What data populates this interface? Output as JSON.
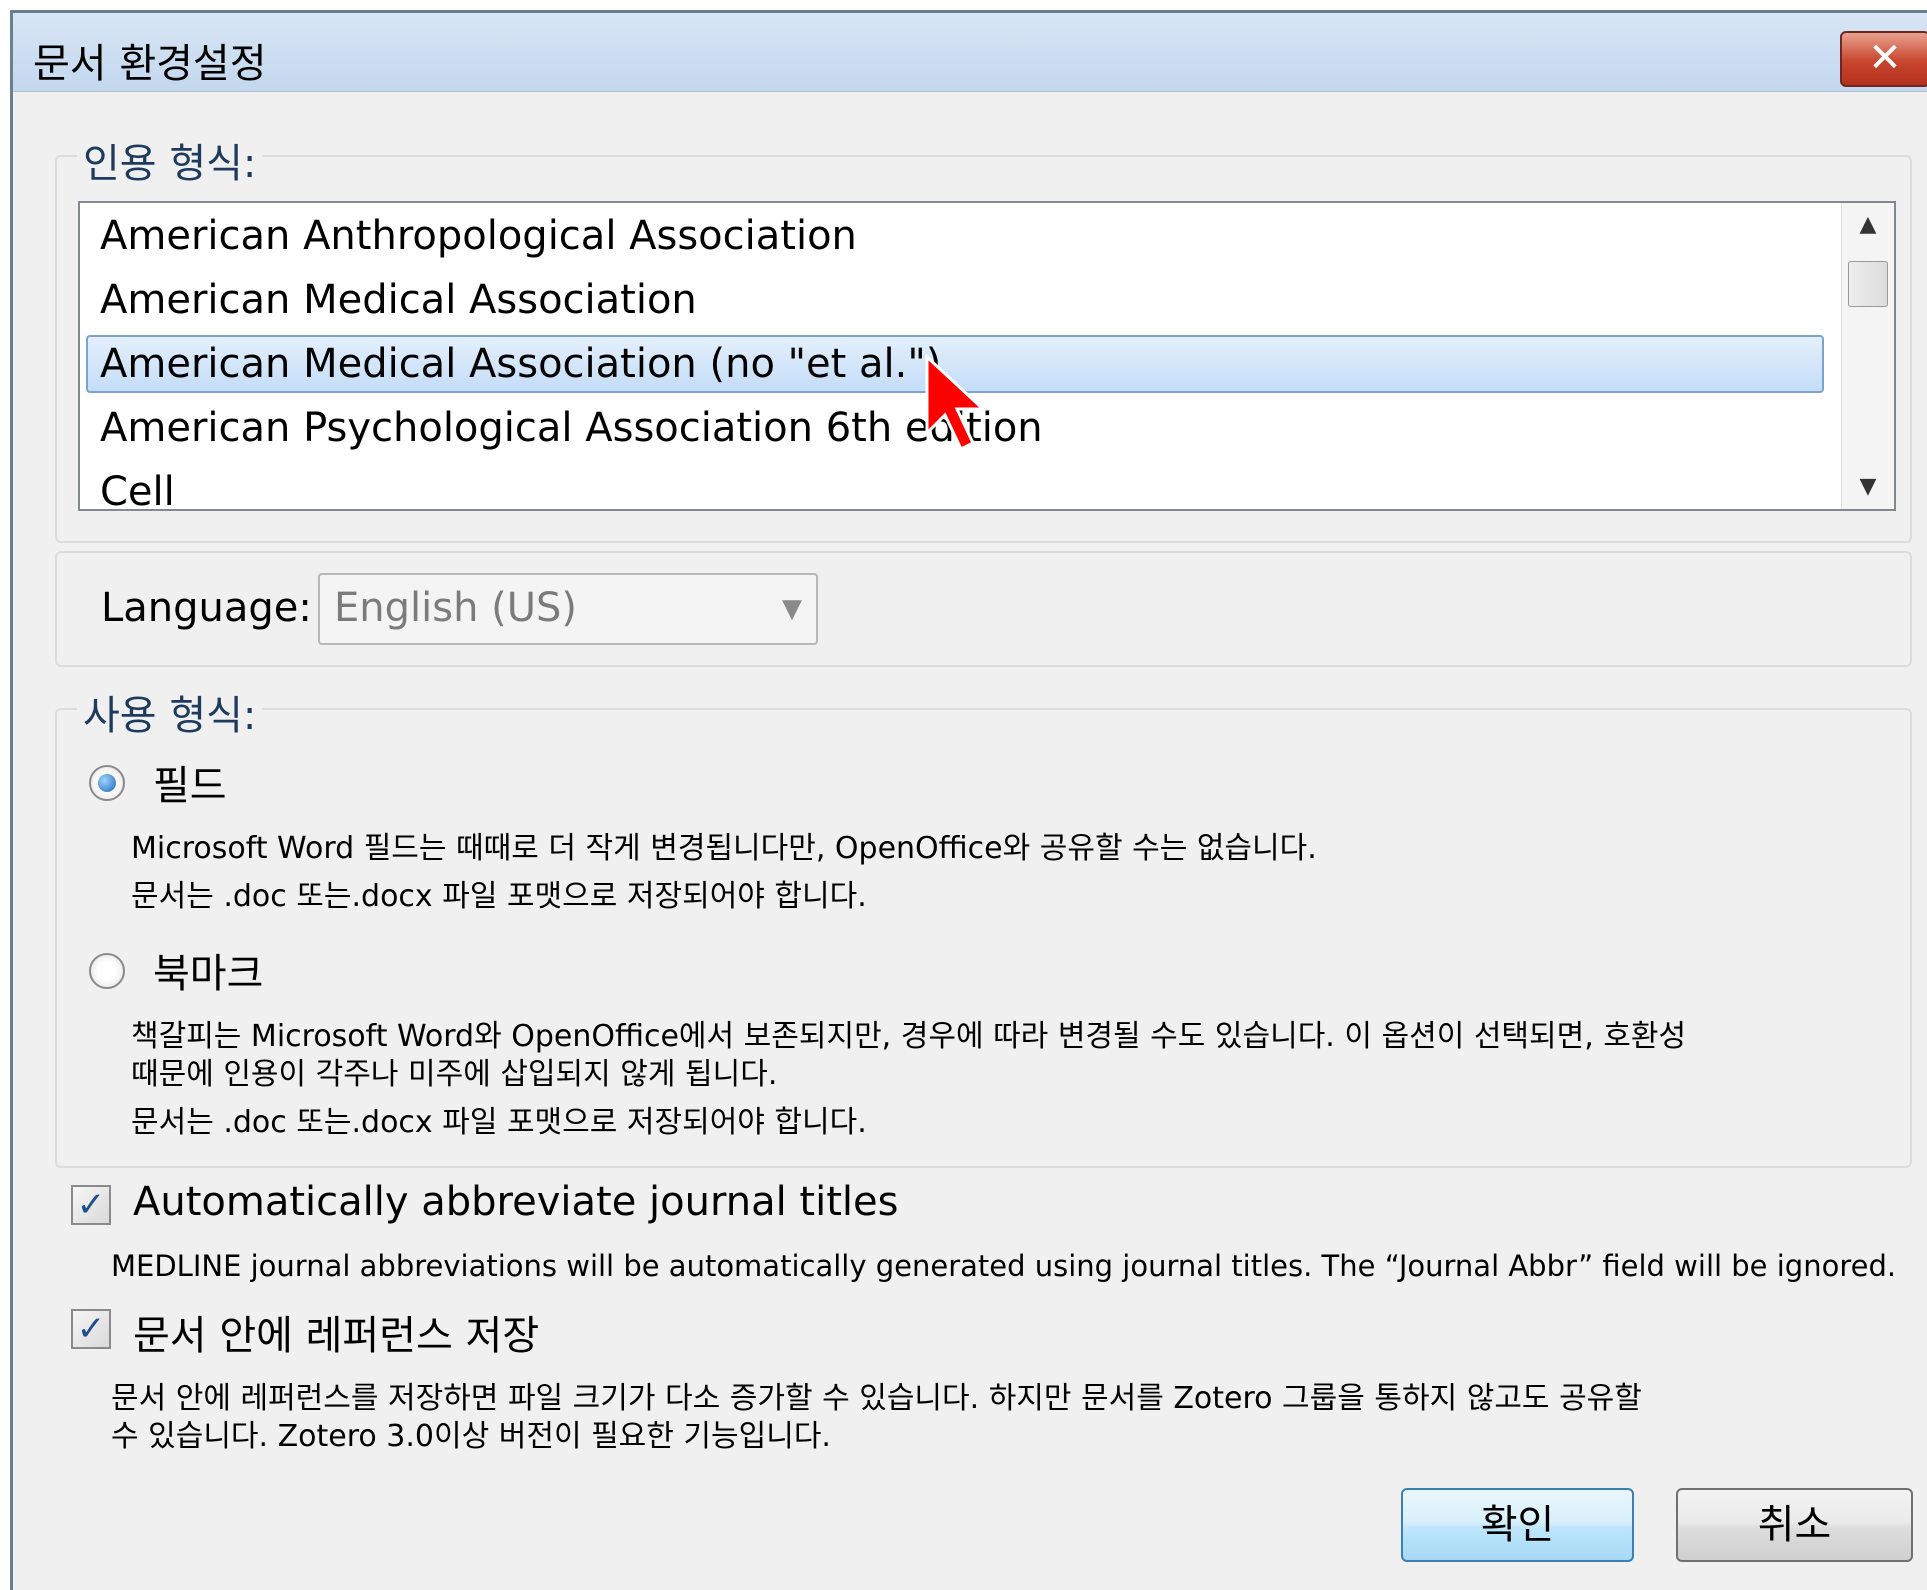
{
  "window": {
    "title": "문서 환경설정",
    "close_label": "✕"
  },
  "citation_style": {
    "legend": "인용 형식:",
    "items": [
      "American Anthropological Association",
      "American Medical Association",
      "American Medical Association (no \"et al.\")",
      "American Psychological Association 6th edition",
      "Cell"
    ],
    "selected_index": 2
  },
  "language": {
    "label": "Language:",
    "value": "English (US)"
  },
  "format": {
    "legend": "사용 형식:",
    "options": [
      {
        "label": "필드",
        "selected": true,
        "description": [
          "Microsoft Word 필드는 때때로 더 작게 변경됩니다만, OpenOffice와 공유할 수는 없습니다.",
          "문서는 .doc 또는.docx 파일 포맷으로 저장되어야 합니다."
        ]
      },
      {
        "label": "북마크",
        "selected": false,
        "description": [
          "책갈피는 Microsoft Word와 OpenOffice에서 보존되지만, 경우에 따라 변경될 수도 있습니다. 이 옵션이 선택되면, 호환성",
          "때문에 인용이 각주나 미주에 삽입되지 않게 됩니다.",
          "문서는 .doc 또는.docx 파일 포맷으로 저장되어야 합니다."
        ]
      }
    ]
  },
  "options": {
    "abbreviate": {
      "label": "Automatically abbreviate journal titles",
      "checked": true,
      "description": "MEDLINE journal abbreviations will be automatically generated using journal titles. The “Journal Abbr” field will be ignored."
    },
    "store_references": {
      "label": "문서 안에 레퍼런스 저장",
      "checked": true,
      "description": [
        "문서 안에 레퍼런스를 저장하면 파일 크기가 다소 증가할 수 있습니다. 하지만 문서를 Zotero 그룹을 통하지 않고도 공유할",
        "수 있습니다. Zotero 3.0이상 버전이 필요한 기능입니다."
      ]
    }
  },
  "buttons": {
    "ok": "확인",
    "cancel": "취소"
  }
}
